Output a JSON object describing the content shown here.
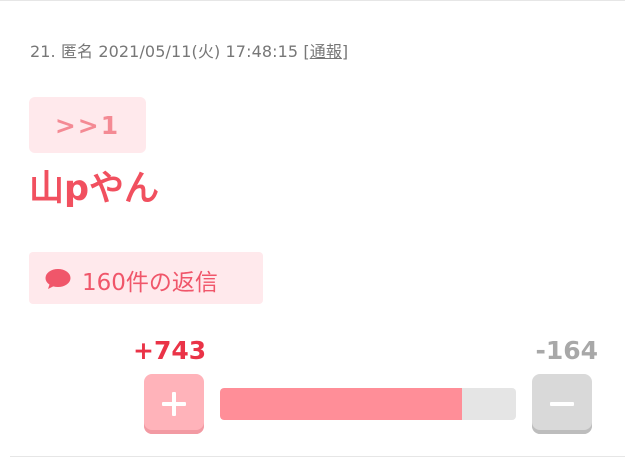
{
  "comment_header": {
    "number": "21.",
    "author": "匿名",
    "timestamp": "2021/05/11(火) 17:48:15",
    "report_open": "[",
    "report_label": "通報",
    "report_close": "]"
  },
  "anchor_label": ">>1",
  "comment_text": "山pやん",
  "replies": {
    "icon": "speech-bubble-icon",
    "label": "160件の返信"
  },
  "votes": {
    "plus_label": "+743",
    "minus_label": "-164",
    "plus_value": 743,
    "minus_value": 164,
    "plus_icon": "plus-icon",
    "minus_icon": "minus-icon"
  },
  "colors": {
    "accent": "#f1505f",
    "accent_bg": "#ffe9ec",
    "plus_count": "#ea3347",
    "minus_count": "#a8a8a8",
    "bar_fill": "#ff8e98",
    "bar_track": "#e5e5e5"
  }
}
